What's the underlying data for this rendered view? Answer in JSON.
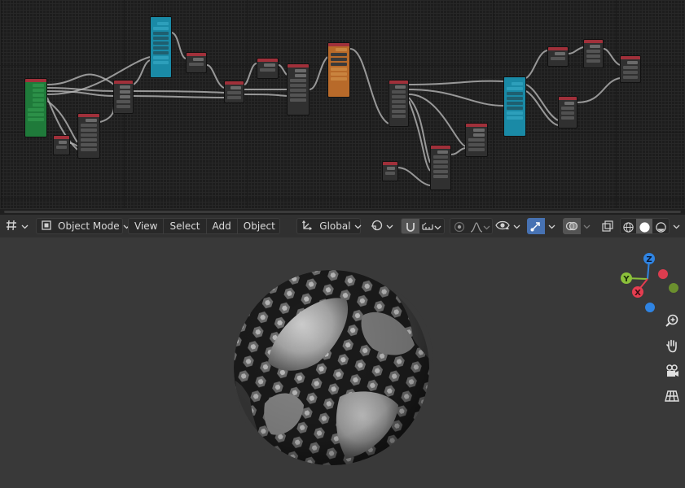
{
  "window": {
    "editor_top": "Shader Editor",
    "editor_bottom": "3D Viewport"
  },
  "header": {
    "editor_type_icon": "node-editor-type-icon",
    "mode_select": {
      "label": "Object Mode",
      "icon": "object-mode-icon"
    },
    "menus": [
      "View",
      "Select",
      "Add",
      "Object"
    ],
    "orientation_select": {
      "label": "Global",
      "icon": "transform-orientation-icon"
    },
    "pivot_icon": "pivot-point-icon",
    "snap_icon": "snap-icon",
    "snap_target_icon": "snap-increment-icon",
    "proportional_icon": "proportional-edit-icon",
    "falloff_icon": "falloff-curve-icon",
    "visibility_icon": "eye-icon",
    "gizmo_icon": "gizmo-icon",
    "overlay_icon": "overlays-icon",
    "xray_icon": "xray-icon",
    "shading_modes": [
      "wireframe",
      "solid",
      "material-preview"
    ]
  },
  "colors": {
    "accent": "#4772b3",
    "axis_x": "#e43d50",
    "axis_y": "#8bc03a",
    "axis_z": "#2f84e3",
    "node_header_red": "#a0303a",
    "node_teal": "#1a8aa6",
    "node_green": "#1f7a3a",
    "node_orange": "#b86a2a"
  },
  "gizmo": {
    "labels": {
      "x": "X",
      "y": "Y",
      "z": "Z"
    }
  },
  "nav_tools": [
    "zoom-icon",
    "pan-hand-icon",
    "camera-icon",
    "ortho-grid-icon"
  ]
}
